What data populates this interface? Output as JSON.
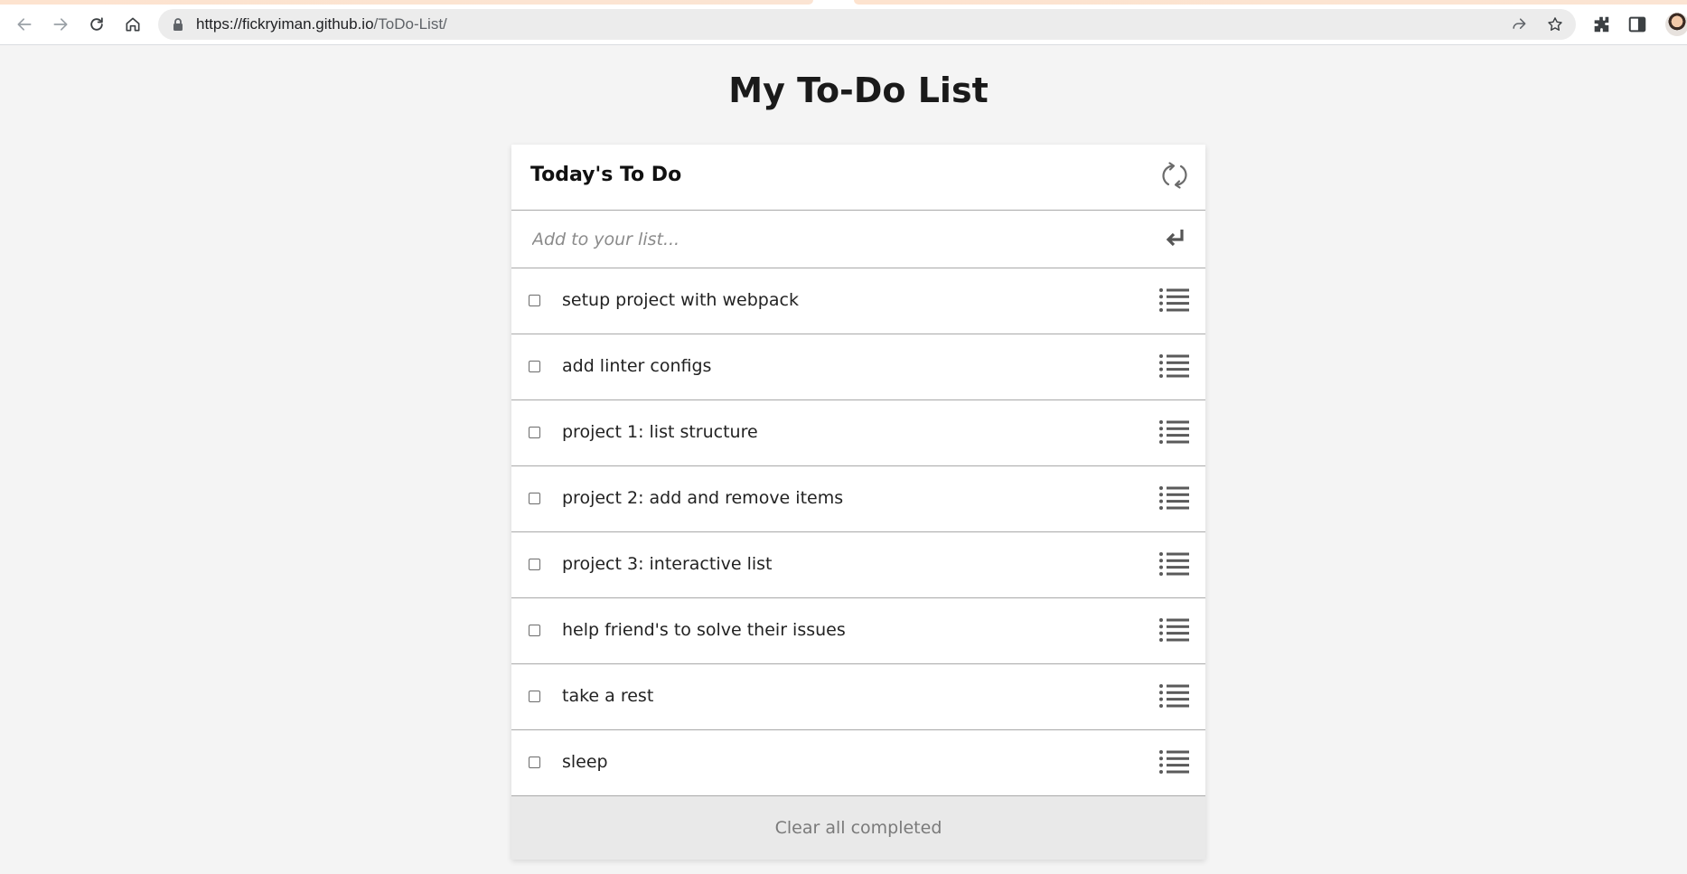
{
  "browser": {
    "url_host": "https://fickryiman.github.io",
    "url_path": "/ToDo-List/"
  },
  "page": {
    "title": "My To-Do List"
  },
  "card": {
    "header_title": "Today's To Do",
    "add_placeholder": "Add to your list...",
    "items": [
      {
        "description": "setup project with webpack",
        "completed": false
      },
      {
        "description": "add linter configs",
        "completed": false
      },
      {
        "description": "project 1: list structure",
        "completed": false
      },
      {
        "description": "project 2: add and remove items",
        "completed": false
      },
      {
        "description": "project 3: interactive list",
        "completed": false
      },
      {
        "description": "help friend's to solve their issues",
        "completed": false
      },
      {
        "description": "take a rest",
        "completed": false
      },
      {
        "description": "sleep",
        "completed": false
      }
    ],
    "clear_label": "Clear all completed"
  },
  "icons": {
    "refresh": "refresh-icon",
    "enter": "enter-icon",
    "drag": "list-icon"
  }
}
